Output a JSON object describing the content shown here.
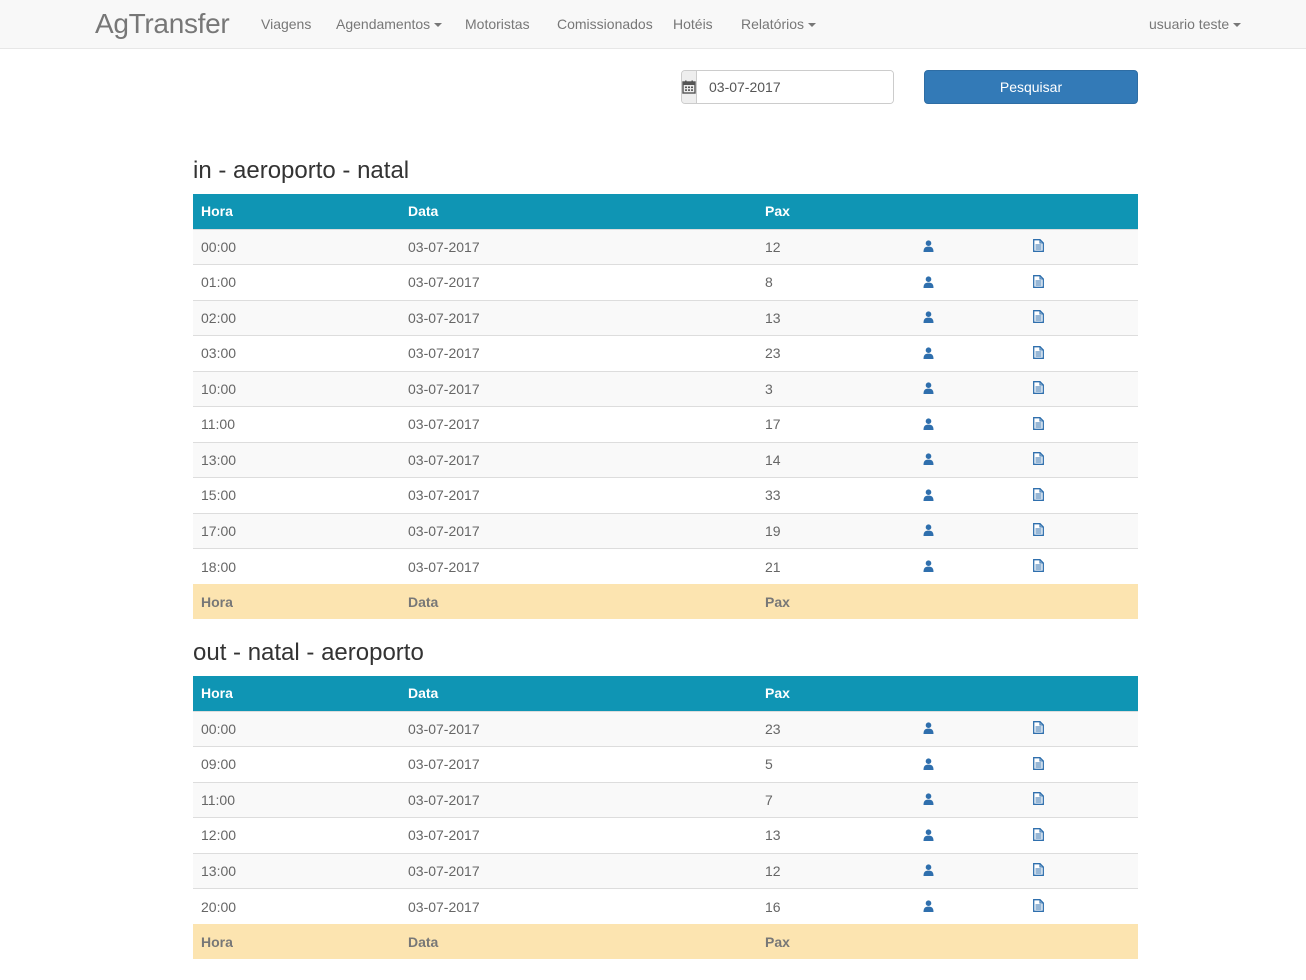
{
  "navbar": {
    "brand": "AgTransfer",
    "items": [
      {
        "label": "Viagens"
      },
      {
        "label": "Agendamentos"
      },
      {
        "label": "Motoristas"
      },
      {
        "label": "Comissionados"
      },
      {
        "label": "Hotéis"
      },
      {
        "label": "Relatórios"
      }
    ],
    "user": "usuario teste"
  },
  "search": {
    "date_value": "03-07-2017",
    "button_label": "Pesquisar",
    "icon": "calendar-icon"
  },
  "columns": {
    "hora": "Hora",
    "data": "Data",
    "pax": "Pax"
  },
  "sections": [
    {
      "title": "in - aeroporto - natal",
      "rows": [
        {
          "hora": "00:00",
          "data": "03-07-2017",
          "pax": "12"
        },
        {
          "hora": "01:00",
          "data": "03-07-2017",
          "pax": "8"
        },
        {
          "hora": "02:00",
          "data": "03-07-2017",
          "pax": "13"
        },
        {
          "hora": "03:00",
          "data": "03-07-2017",
          "pax": "23"
        },
        {
          "hora": "10:00",
          "data": "03-07-2017",
          "pax": "3"
        },
        {
          "hora": "11:00",
          "data": "03-07-2017",
          "pax": "17"
        },
        {
          "hora": "13:00",
          "data": "03-07-2017",
          "pax": "14"
        },
        {
          "hora": "15:00",
          "data": "03-07-2017",
          "pax": "33"
        },
        {
          "hora": "17:00",
          "data": "03-07-2017",
          "pax": "19"
        },
        {
          "hora": "18:00",
          "data": "03-07-2017",
          "pax": "21"
        }
      ]
    },
    {
      "title": "out - natal - aeroporto",
      "rows": [
        {
          "hora": "00:00",
          "data": "03-07-2017",
          "pax": "23"
        },
        {
          "hora": "09:00",
          "data": "03-07-2017",
          "pax": "5"
        },
        {
          "hora": "11:00",
          "data": "03-07-2017",
          "pax": "7"
        },
        {
          "hora": "12:00",
          "data": "03-07-2017",
          "pax": "13"
        },
        {
          "hora": "13:00",
          "data": "03-07-2017",
          "pax": "12"
        },
        {
          "hora": "20:00",
          "data": "03-07-2017",
          "pax": "16"
        }
      ]
    }
  ],
  "colors": {
    "header": "#0f95b4",
    "footer": "#fce4b0",
    "primary": "#337ab7",
    "icon": "#2f6fad"
  },
  "row_icons": [
    "user-icon",
    "document-icon"
  ]
}
